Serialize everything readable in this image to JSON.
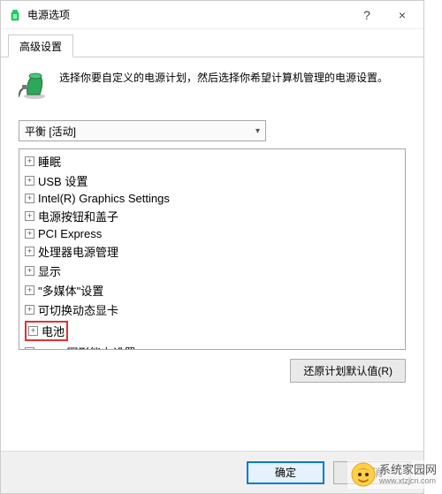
{
  "window": {
    "title": "电源选项",
    "help_icon": "?",
    "close_icon": "×"
  },
  "tab": {
    "label": "高级设置"
  },
  "intro": {
    "text": "选择你要自定义的电源计划，然后选择你希望计算机管理的电源设置。"
  },
  "plan": {
    "selected": "平衡 [活动]"
  },
  "tree": {
    "items": [
      {
        "label": "睡眠",
        "highlighted": false
      },
      {
        "label": "USB 设置",
        "highlighted": false
      },
      {
        "label": "Intel(R) Graphics Settings",
        "highlighted": false
      },
      {
        "label": "电源按钮和盖子",
        "highlighted": false
      },
      {
        "label": "PCI Express",
        "highlighted": false
      },
      {
        "label": "处理器电源管理",
        "highlighted": false
      },
      {
        "label": "显示",
        "highlighted": false
      },
      {
        "label": "\"多媒体\"设置",
        "highlighted": false
      },
      {
        "label": "可切换动态显卡",
        "highlighted": false
      },
      {
        "label": "电池",
        "highlighted": true
      },
      {
        "label": "AMD 图形能力设置",
        "highlighted": false
      }
    ]
  },
  "buttons": {
    "restore": "还原计划默认值(R)",
    "ok": "确定",
    "cancel": "取消"
  },
  "watermark": {
    "name": "系统家园网",
    "url": "www.xtzjcn.com"
  }
}
